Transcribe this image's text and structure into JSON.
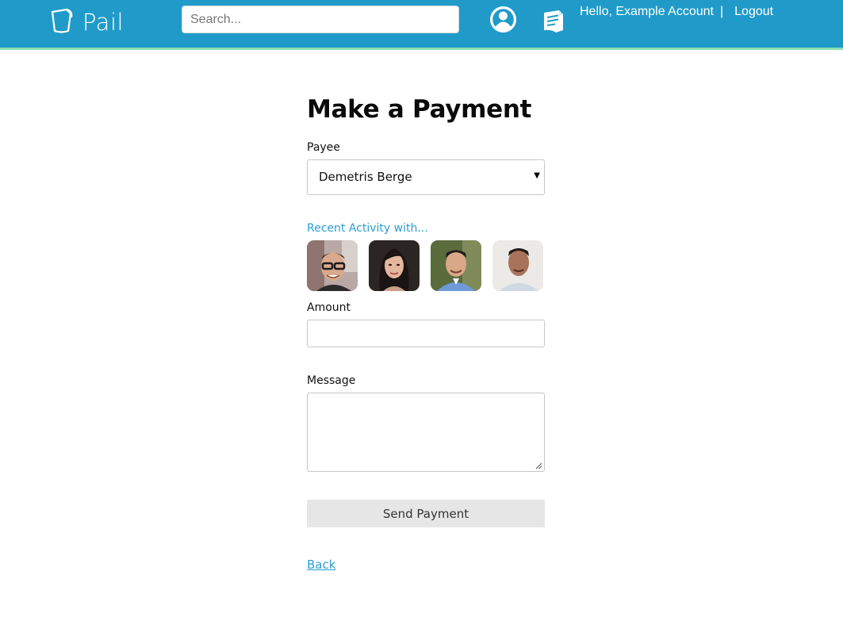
{
  "header": {
    "brand": "Pail",
    "search_placeholder": "Search...",
    "greeting": "Hello, Example Account",
    "separator": "|",
    "logout": "Logout",
    "icons": [
      "pail-logo-icon",
      "profile-icon",
      "notes-icon"
    ],
    "colors": {
      "bar": "#209bc9",
      "accent_line": "#8fe0b0"
    }
  },
  "form": {
    "title": "Make a Payment",
    "payee_label": "Payee",
    "payee_value": "Demetris Berge",
    "recent_activity_label": "Recent Activity with...",
    "amount_label": "Amount",
    "amount_value": "",
    "message_label": "Message",
    "message_value": "",
    "send_button": "Send Payment",
    "back_link": "Back",
    "colors": {
      "link": "#2a9fd0",
      "button_bg": "#e6e6e6"
    }
  }
}
